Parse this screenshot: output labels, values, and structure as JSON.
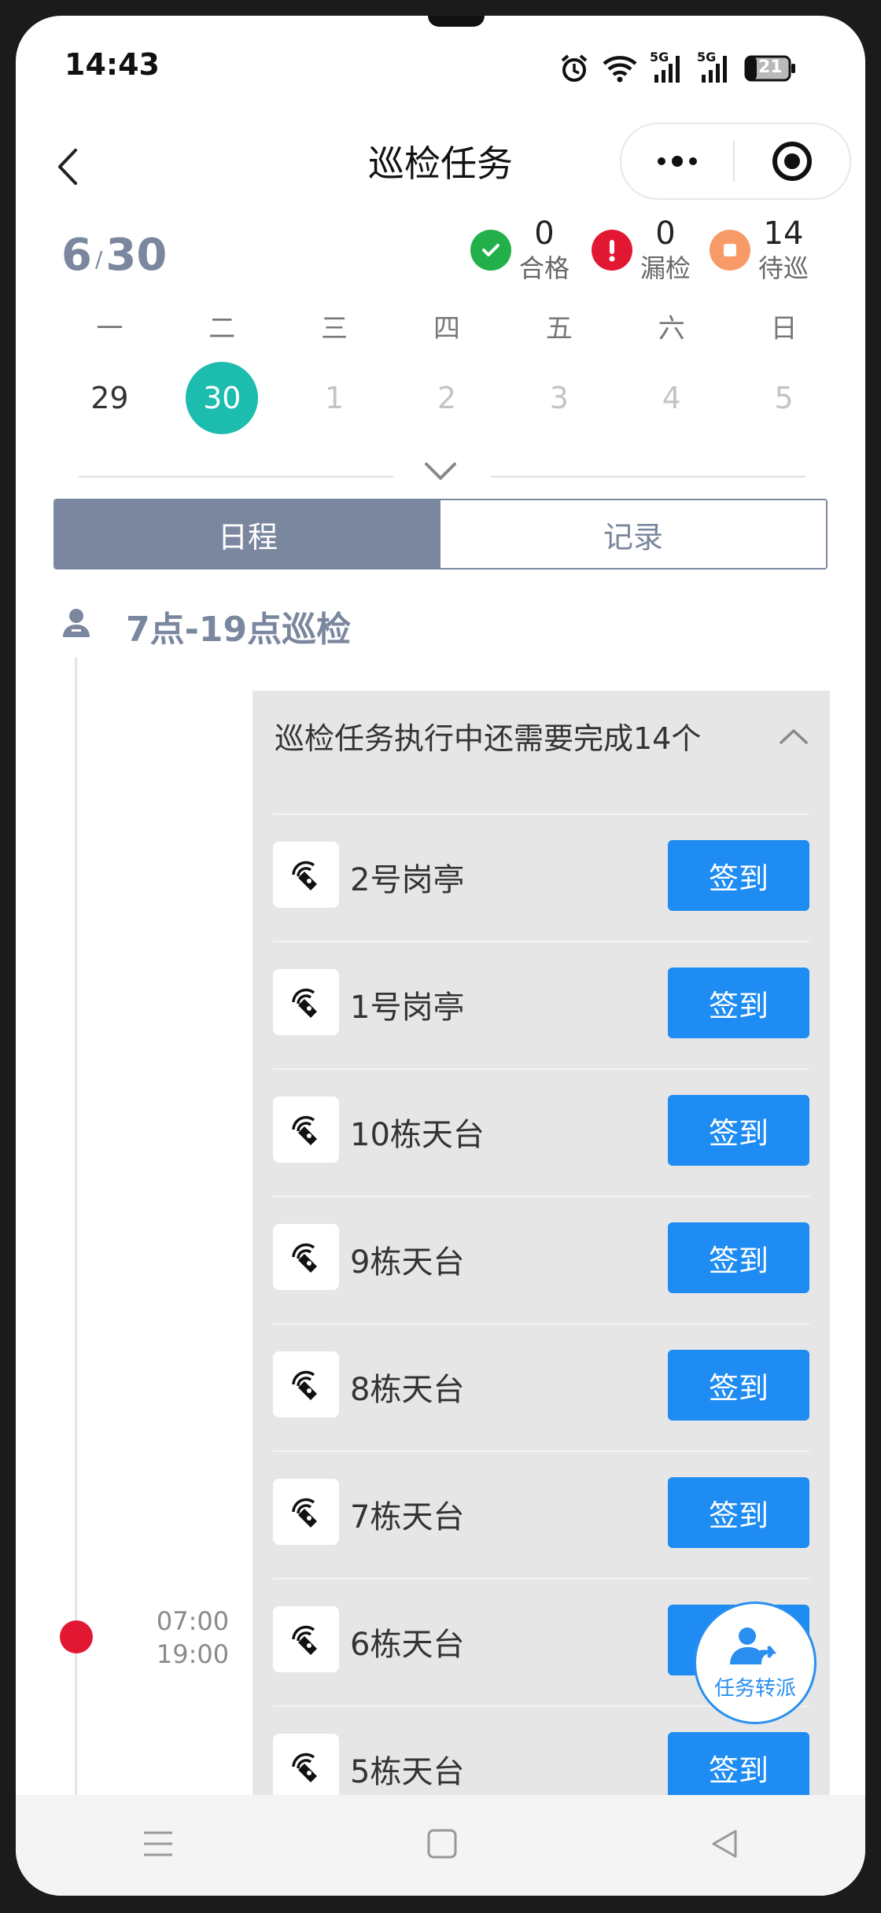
{
  "status_bar": {
    "time": "14:43",
    "network_1": "5G",
    "network_2": "5G",
    "battery": "21"
  },
  "header": {
    "title": "巡检任务"
  },
  "summary": {
    "date_month": "6",
    "date_day": "30",
    "stats": [
      {
        "count": "0",
        "label": "合格",
        "color": "#22b04b"
      },
      {
        "count": "0",
        "label": "漏检",
        "color": "#e21833"
      },
      {
        "count": "14",
        "label": "待巡",
        "color": "#f89a68"
      }
    ]
  },
  "calendar": {
    "weekdays": [
      "一",
      "二",
      "三",
      "四",
      "五",
      "六",
      "日"
    ],
    "days": [
      "29",
      "30",
      "1",
      "2",
      "3",
      "4",
      "5"
    ],
    "selected_day": "30"
  },
  "tabs": [
    {
      "label": "日程"
    },
    {
      "label": "记录"
    }
  ],
  "shift": {
    "title": "7点-19点巡检",
    "start_time": "07:00",
    "end_time": "19:00"
  },
  "task_panel": {
    "summary": "巡检任务执行中还需要完成14个",
    "checkin_label": "签到",
    "items": [
      {
        "name": "2号岗亭"
      },
      {
        "name": "1号岗亭"
      },
      {
        "name": "10栋天台"
      },
      {
        "name": "9栋天台"
      },
      {
        "name": "8栋天台"
      },
      {
        "name": "7栋天台"
      },
      {
        "name": "6栋天台"
      },
      {
        "name": "5栋天台"
      }
    ]
  },
  "fab": {
    "label": "任务转派"
  },
  "colors": {
    "accent": "#1e8cf2",
    "primary_gray": "#7b879e",
    "teal": "#1cbcae",
    "danger": "#e21833"
  }
}
